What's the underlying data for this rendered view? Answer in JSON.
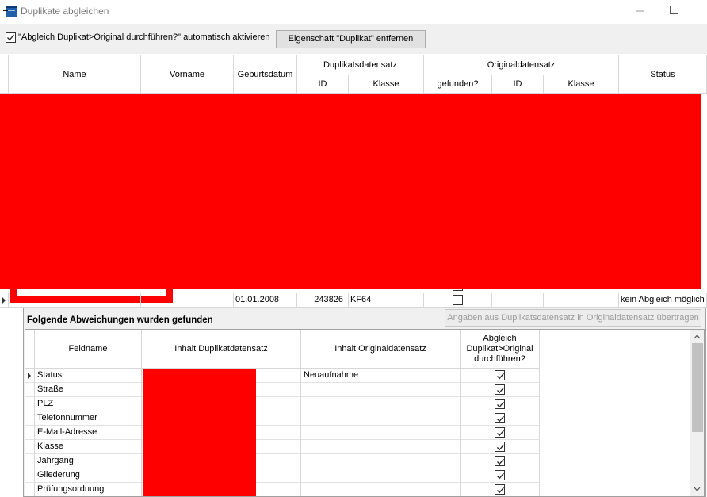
{
  "window": {
    "title": "Duplikate abgleichen"
  },
  "toolbar": {
    "auto_activate_checked": true,
    "auto_activate_label": "\"Abgleich Duplikat>Original durchführen?\" automatisch aktivieren",
    "remove_button_label": "Eigenschaft \"Duplikat\" entfernen"
  },
  "main_grid": {
    "headers": {
      "name": "Name",
      "vorname": "Vorname",
      "geburtsdatum": "Geburtsdatum",
      "duplikat_group": "Duplikatsdatensatz",
      "dup_id": "ID",
      "dup_klasse": "Klasse",
      "original_group": "Originaldatensatz",
      "orig_gefunden": "gefunden?",
      "orig_id": "ID",
      "orig_klasse": "Klasse",
      "status": "Status"
    },
    "current_row": {
      "geburtsdatum": "01.01.2008",
      "dup_id": "243826",
      "dup_klasse": "KF64",
      "gefunden_checked": false,
      "status": "kein Abgleich möglich"
    }
  },
  "detail": {
    "title": "Folgende Abweichungen wurden gefunden",
    "transfer_button_label": "Angaben aus Duplikatsdatensatz in Originaldatensatz übertragen",
    "headers": {
      "feldname": "Feldname",
      "inhalt_duplikat": "Inhalt Duplikatdatensatz",
      "inhalt_original": "Inhalt Originaldatensatz",
      "abgleich": "Abgleich Duplikat>Original durchführen?"
    },
    "rows": [
      {
        "feldname": "Status",
        "original": "Neuaufnahme",
        "checked": true
      },
      {
        "feldname": "Straße",
        "original": "",
        "checked": true
      },
      {
        "feldname": "PLZ",
        "original": "",
        "checked": true
      },
      {
        "feldname": "Telefonnummer",
        "original": "",
        "checked": true
      },
      {
        "feldname": "E-Mail-Adresse",
        "original": "",
        "checked": true
      },
      {
        "feldname": "Klasse",
        "original": "",
        "checked": true
      },
      {
        "feldname": "Jahrgang",
        "original": "",
        "checked": true
      },
      {
        "feldname": "Gliederung",
        "original": "",
        "checked": true
      },
      {
        "feldname": "Prüfungsordnung",
        "original": "",
        "checked": true
      }
    ]
  },
  "colors": {
    "redaction": "#ff0000",
    "toolbar_bg": "#f0f0f0",
    "grid_line": "#d8d8d8"
  }
}
